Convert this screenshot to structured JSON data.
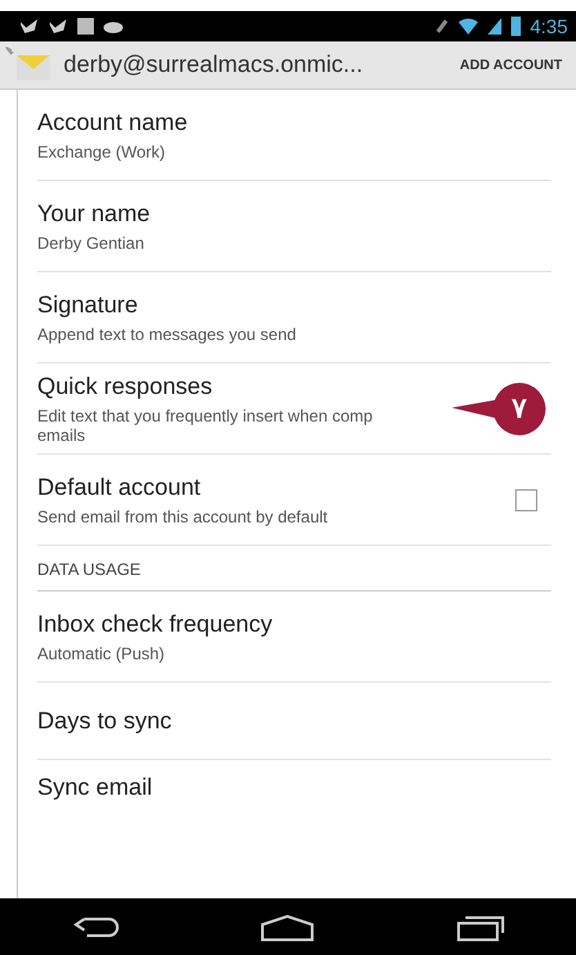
{
  "status_bar": {
    "time": "4:35"
  },
  "action_bar": {
    "account": "derby@surrealmacs.onmic...",
    "action": "ADD ACCOUNT"
  },
  "settings": [
    {
      "kind": "item",
      "title": "Account name",
      "summary": "Exchange (Work)"
    },
    {
      "kind": "item",
      "title": "Your name",
      "summary": "Derby Gentian"
    },
    {
      "kind": "item",
      "title": "Signature",
      "summary": "Append text to messages you send"
    },
    {
      "kind": "item",
      "title": "Quick responses",
      "summary": "Edit text that you frequently insert when comp emails"
    },
    {
      "kind": "checkbox",
      "title": "Default account",
      "summary": "Send email from this account by default",
      "checked": false
    },
    {
      "kind": "header",
      "title": "DATA USAGE"
    },
    {
      "kind": "item",
      "title": "Inbox check frequency",
      "summary": "Automatic (Push)"
    },
    {
      "kind": "item",
      "title": "Days to sync"
    },
    {
      "kind": "item",
      "title": "Sync email"
    }
  ],
  "callout": {
    "label": "٧"
  }
}
